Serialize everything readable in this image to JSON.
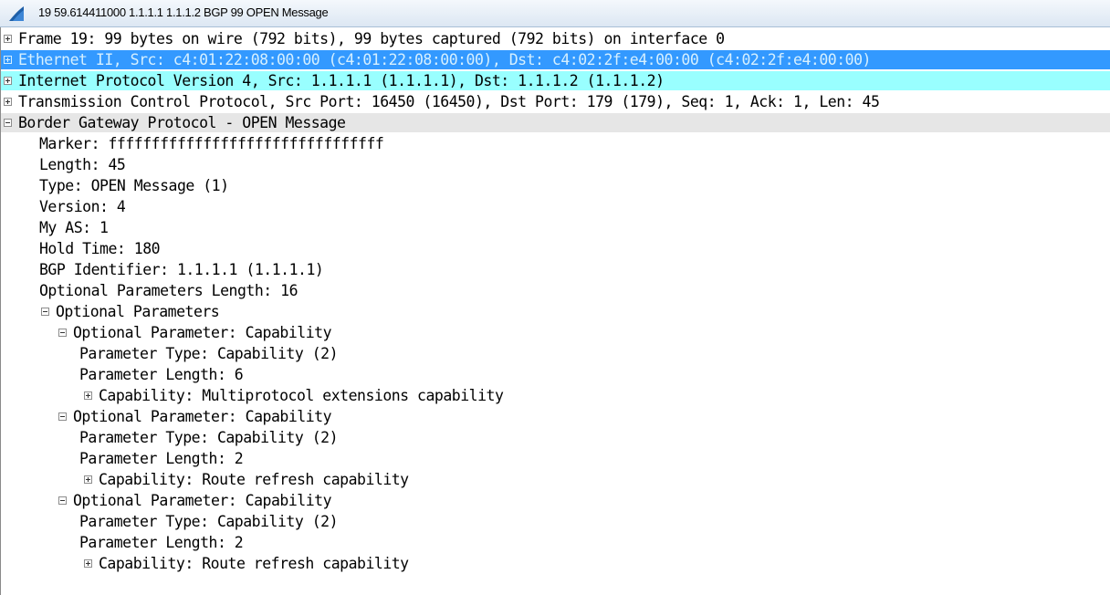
{
  "window": {
    "title": "19 59.614411000 1.1.1.1 1.1.1.2 BGP 99 OPEN Message",
    "icon": "wireshark-fin-icon",
    "icon_color": "#1e5fa8"
  },
  "colors": {
    "selected_row": "#3399ff",
    "ip_row": "#99ffff",
    "bgp_header_row": "#e6e6e6"
  },
  "rows": [
    {
      "name": "frame",
      "text": "Frame 19: 99 bytes on wire (792 bits), 99 bytes captured (792 bits) on interface 0",
      "expander": "plus",
      "level": 0
    },
    {
      "name": "ethernet",
      "text": "Ethernet II, Src: c4:01:22:08:00:00 (c4:01:22:08:00:00), Dst: c4:02:2f:e4:00:00 (c4:02:2f:e4:00:00)",
      "expander": "plus",
      "level": 0,
      "style": "selected"
    },
    {
      "name": "ipv4",
      "text": "Internet Protocol Version 4, Src: 1.1.1.1 (1.1.1.1), Dst: 1.1.1.2 (1.1.1.2)",
      "expander": "plus",
      "level": 0,
      "style": "cyan"
    },
    {
      "name": "tcp",
      "text": "Transmission Control Protocol, Src Port: 16450 (16450), Dst Port: 179 (179), Seq: 1, Ack: 1, Len: 45",
      "expander": "plus",
      "level": 0
    },
    {
      "name": "bgp",
      "text": "Border Gateway Protocol - OPEN Message",
      "expander": "minus",
      "level": 0,
      "style": "gray"
    },
    {
      "name": "marker",
      "text": "Marker: ffffffffffffffffffffffffffffffff",
      "expander": "none",
      "level": 1
    },
    {
      "name": "length",
      "text": "Length: 45",
      "expander": "none",
      "level": 1
    },
    {
      "name": "type",
      "text": "Type: OPEN Message (1)",
      "expander": "none",
      "level": 1
    },
    {
      "name": "version",
      "text": "Version: 4",
      "expander": "none",
      "level": 1
    },
    {
      "name": "my-as",
      "text": "My AS: 1",
      "expander": "none",
      "level": 1
    },
    {
      "name": "hold-time",
      "text": "Hold Time: 180",
      "expander": "none",
      "level": 1
    },
    {
      "name": "bgp-identifier",
      "text": "BGP Identifier: 1.1.1.1 (1.1.1.1)",
      "expander": "none",
      "level": 1
    },
    {
      "name": "opt-params-length",
      "text": "Optional Parameters Length: 16",
      "expander": "none",
      "level": 1
    },
    {
      "name": "optional-parameters",
      "text": "Optional Parameters",
      "expander": "minus",
      "level": 1
    },
    {
      "name": "opt-param-1",
      "text": "Optional Parameter: Capability",
      "expander": "minus",
      "level": 2
    },
    {
      "name": "opt-param-1-type",
      "text": "Parameter Type: Capability (2)",
      "expander": "none",
      "level": 3
    },
    {
      "name": "opt-param-1-length",
      "text": "Parameter Length: 6",
      "expander": "none",
      "level": 3
    },
    {
      "name": "opt-param-1-capability",
      "text": "Capability: Multiprotocol extensions capability",
      "expander": "plus",
      "level": 3
    },
    {
      "name": "opt-param-2",
      "text": "Optional Parameter: Capability",
      "expander": "minus",
      "level": 2
    },
    {
      "name": "opt-param-2-type",
      "text": "Parameter Type: Capability (2)",
      "expander": "none",
      "level": 3
    },
    {
      "name": "opt-param-2-length",
      "text": "Parameter Length: 2",
      "expander": "none",
      "level": 3
    },
    {
      "name": "opt-param-2-capability",
      "text": "Capability: Route refresh capability",
      "expander": "plus",
      "level": 3
    },
    {
      "name": "opt-param-3",
      "text": "Optional Parameter: Capability",
      "expander": "minus",
      "level": 2
    },
    {
      "name": "opt-param-3-type",
      "text": "Parameter Type: Capability (2)",
      "expander": "none",
      "level": 3
    },
    {
      "name": "opt-param-3-length",
      "text": "Parameter Length: 2",
      "expander": "none",
      "level": 3
    },
    {
      "name": "opt-param-3-capability",
      "text": "Capability: Route refresh capability",
      "expander": "plus",
      "level": 3
    }
  ]
}
